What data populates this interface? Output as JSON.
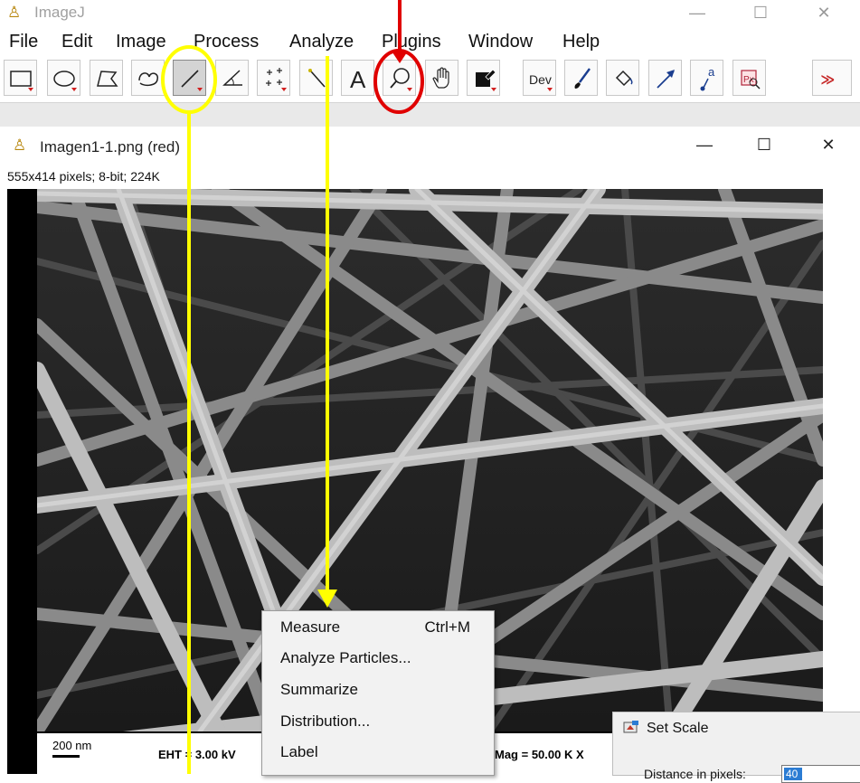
{
  "window": {
    "app_icon": "microscope-icon",
    "title": "ImageJ",
    "controls": {
      "minimize": "—",
      "maximize": "☐",
      "close": "✕"
    }
  },
  "menubar": [
    "File",
    "Edit",
    "Image",
    "Process",
    "Analyze",
    "Plugins",
    "Window",
    "Help"
  ],
  "toolbar": {
    "tools": [
      {
        "name": "rectangle-tool-icon"
      },
      {
        "name": "oval-tool-icon"
      },
      {
        "name": "polygon-tool-icon"
      },
      {
        "name": "freehand-tool-icon"
      },
      {
        "name": "straight-line-tool-icon",
        "selected": true
      },
      {
        "name": "angle-tool-icon"
      },
      {
        "name": "multi-point-tool-icon"
      },
      {
        "name": "wand-tool-icon"
      },
      {
        "name": "text-tool-icon",
        "label": "A"
      },
      {
        "name": "magnifying-glass-tool-icon"
      },
      {
        "name": "hand-scroll-tool-icon"
      },
      {
        "name": "color-picker-tool-icon"
      },
      {
        "name": "dev-menu-icon",
        "label": "Dev"
      },
      {
        "name": "paintbrush-tool-icon"
      },
      {
        "name": "flood-fill-tool-icon"
      },
      {
        "name": "arrow-tool-icon"
      },
      {
        "name": "label-tool-icon",
        "label": "a"
      },
      {
        "name": "pixel-inspector-icon",
        "label": "Px"
      },
      {
        "name": "more-tools-icon",
        "label": "≫"
      }
    ]
  },
  "image_window": {
    "app_icon": "microscope-icon",
    "title": "Imagen1-1.png (red)",
    "info": "555x414 pixels; 8-bit; 224K",
    "controls": {
      "minimize": "—",
      "maximize": "☐",
      "close": "✕"
    },
    "databar": {
      "scale": "200 nm",
      "eht": "EHT =  3.00 kV",
      "mag": "Mag =  50.00 K X"
    }
  },
  "analyze_menu": {
    "items": [
      {
        "label": "Measure",
        "shortcut": "Ctrl+M"
      },
      {
        "label": "Analyze Particles...",
        "shortcut": ""
      },
      {
        "label": "Summarize",
        "shortcut": ""
      },
      {
        "label": "Distribution...",
        "shortcut": ""
      },
      {
        "label": "Label",
        "shortcut": ""
      }
    ]
  },
  "set_scale_dialog": {
    "icon": "set-scale-icon",
    "title": "Set Scale",
    "distance_label": "Distance in pixels:",
    "distance_value": "40"
  },
  "annotations": {
    "yellow_circle_target": "straight-line-tool",
    "red_circle_target": "magnifying-glass-tool",
    "yellow": "#ffff00",
    "red": "#e00000"
  }
}
